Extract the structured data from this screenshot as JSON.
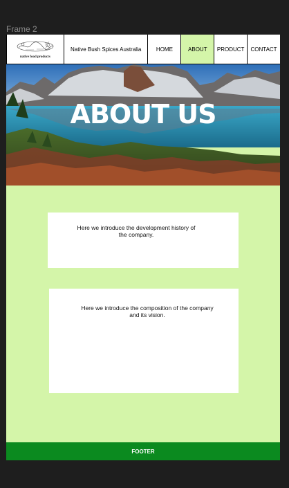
{
  "frame": {
    "label": "Frame 2"
  },
  "header": {
    "logo": {
      "tagline": "native food products"
    },
    "brand": "Native Bush Spices Australia",
    "nav": [
      {
        "label": "HOME",
        "active": false
      },
      {
        "label": "ABOUT",
        "active": true
      },
      {
        "label": "PRODUCT",
        "active": false
      },
      {
        "label": "CONTACT",
        "active": false
      }
    ]
  },
  "hero": {
    "title": "ABOUT US",
    "image": "mountain-lake-landscape"
  },
  "sections": [
    {
      "text": "Here we introduce the development history of the company."
    },
    {
      "text": "Here we introduce the composition of the company and its vision."
    }
  ],
  "footer": {
    "label": "FOOTER"
  },
  "colors": {
    "canvas": "#1e1e1e",
    "page_background": "#d4f5a9",
    "active_nav": "#d4f5a9",
    "footer": "#0b8a1f",
    "card": "#ffffff"
  }
}
